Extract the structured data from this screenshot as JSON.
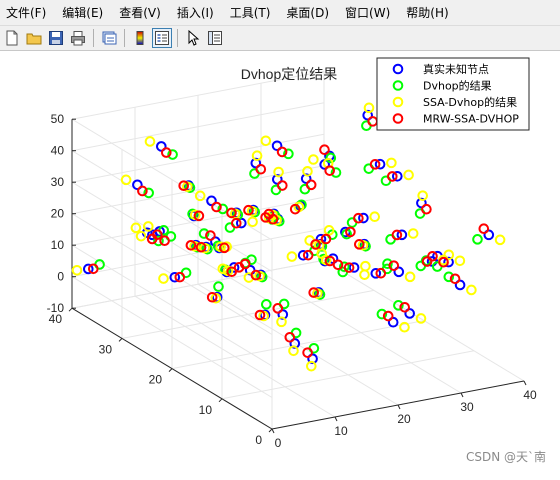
{
  "menubar": {
    "items": [
      {
        "label": "文件(F)"
      },
      {
        "label": "编辑(E)"
      },
      {
        "label": "查看(V)"
      },
      {
        "label": "插入(I)"
      },
      {
        "label": "工具(T)"
      },
      {
        "label": "桌面(D)"
      },
      {
        "label": "窗口(W)"
      },
      {
        "label": "帮助(H)"
      }
    ]
  },
  "toolbar": {
    "icons": [
      "new-file-icon",
      "open-folder-icon",
      "save-icon",
      "print-icon",
      "link-figure-icon",
      "colorbar-icon",
      "legend-icon",
      "pointer-icon",
      "property-inspector-icon"
    ]
  },
  "colors": {
    "true_nodes": "#0000ff",
    "dvhop": "#00ff00",
    "ssa_dvhop": "#ffff00",
    "mrw_ssa_dvhop": "#ff0000"
  },
  "chart_data": {
    "type": "scatter",
    "projection": "3d",
    "title": "Dvhop定位结果",
    "xlabel": "",
    "ylabel": "",
    "zlabel": "",
    "xlim": [
      0,
      40
    ],
    "ylim": [
      0,
      40
    ],
    "zlim": [
      -10,
      50
    ],
    "xticks": [
      "0",
      "10",
      "20",
      "30",
      "40"
    ],
    "yticks": [
      "0",
      "10",
      "20",
      "30",
      "40"
    ],
    "zticks": [
      "-10",
      "0",
      "10",
      "20",
      "30",
      "40",
      "50"
    ],
    "grid": true,
    "legend_position": "top-right",
    "legend": [
      "真实未知节点",
      "Dvhop的结果",
      "SSA-Dvhop的结果",
      "MRW-SSA-DVHOP"
    ],
    "series": [
      {
        "name": "真实未知节点",
        "marker": "circle",
        "color": "#0000ff",
        "points": [
          [
            18,
            8,
            38
          ],
          [
            2,
            25,
            28
          ],
          [
            14,
            12,
            44
          ],
          [
            8,
            34,
            16
          ],
          [
            25,
            20,
            48
          ],
          [
            17,
            5,
            30
          ],
          [
            4,
            16,
            15
          ],
          [
            30,
            28,
            12
          ],
          [
            21,
            37,
            4
          ],
          [
            3,
            6,
            32
          ],
          [
            36,
            2,
            36
          ],
          [
            10,
            14,
            9
          ],
          [
            22,
            28,
            22
          ],
          [
            13,
            32,
            22
          ],
          [
            38,
            18,
            30
          ],
          [
            6,
            3,
            12
          ],
          [
            15,
            26,
            28
          ],
          [
            29,
            9,
            7
          ],
          [
            27,
            33,
            38
          ],
          [
            11,
            20,
            32
          ],
          [
            20,
            13,
            24
          ],
          [
            33,
            31,
            1
          ],
          [
            23,
            3,
            40
          ],
          [
            1,
            38,
            4
          ],
          [
            9,
            28,
            37
          ],
          [
            35,
            11,
            21
          ],
          [
            16,
            18,
            3
          ],
          [
            26,
            36,
            30
          ],
          [
            7,
            22,
            24
          ],
          [
            31,
            14,
            45
          ],
          [
            19,
            33,
            1
          ],
          [
            12,
            7,
            1
          ],
          [
            37,
            25,
            36
          ],
          [
            24,
            24,
            13
          ],
          [
            5,
            10,
            48
          ],
          [
            28,
            17,
            30
          ],
          [
            34,
            36,
            22
          ],
          [
            14,
            22,
            14
          ],
          [
            21,
            8,
            33
          ],
          [
            8,
            37,
            29
          ],
          [
            32,
            5,
            26
          ],
          [
            17,
            29,
            7
          ],
          [
            39,
            30,
            46
          ],
          [
            3,
            19,
            29
          ],
          [
            26,
            12,
            18
          ],
          [
            11,
            36,
            41
          ],
          [
            22,
            18,
            23
          ],
          [
            36,
            20,
            7
          ],
          [
            9,
            2,
            28
          ],
          [
            29,
            26,
            38
          ],
          [
            18,
            34,
            10
          ],
          [
            4,
            30,
            22
          ],
          [
            24,
            6,
            9
          ],
          [
            31,
            38,
            21
          ],
          [
            13,
            16,
            38
          ],
          [
            20,
            24,
            26
          ],
          [
            37,
            9,
            13
          ],
          [
            6,
            27,
            10
          ],
          [
            27,
            2,
            31
          ],
          [
            15,
            31,
            27
          ]
        ]
      },
      {
        "name": "Dvhop的结果",
        "marker": "circle",
        "color": "#00ff00",
        "points": [
          [
            19,
            9,
            36
          ],
          [
            3,
            24,
            27
          ],
          [
            15,
            13,
            43
          ],
          [
            9,
            33,
            18
          ],
          [
            26,
            21,
            46
          ],
          [
            16,
            6,
            28
          ],
          [
            5,
            17,
            17
          ],
          [
            31,
            27,
            14
          ],
          [
            20,
            36,
            6
          ],
          [
            4,
            7,
            30
          ],
          [
            35,
            3,
            34
          ],
          [
            11,
            15,
            11
          ],
          [
            23,
            29,
            20
          ],
          [
            12,
            31,
            24
          ],
          [
            37,
            17,
            28
          ],
          [
            7,
            4,
            14
          ],
          [
            16,
            27,
            26
          ],
          [
            28,
            10,
            9
          ],
          [
            28,
            32,
            36
          ],
          [
            10,
            21,
            30
          ],
          [
            21,
            12,
            22
          ],
          [
            32,
            30,
            3
          ],
          [
            22,
            4,
            38
          ],
          [
            2,
            37,
            6
          ],
          [
            10,
            29,
            35
          ],
          [
            34,
            12,
            19
          ],
          [
            17,
            19,
            5
          ],
          [
            25,
            35,
            28
          ],
          [
            8,
            23,
            22
          ],
          [
            30,
            15,
            43
          ],
          [
            18,
            32,
            3
          ],
          [
            13,
            8,
            3
          ],
          [
            36,
            26,
            34
          ],
          [
            25,
            23,
            15
          ],
          [
            6,
            11,
            46
          ],
          [
            27,
            18,
            28
          ],
          [
            33,
            35,
            20
          ],
          [
            15,
            23,
            16
          ],
          [
            22,
            9,
            31
          ],
          [
            9,
            36,
            27
          ],
          [
            31,
            6,
            24
          ],
          [
            18,
            28,
            9
          ],
          [
            38,
            29,
            44
          ],
          [
            4,
            20,
            27
          ],
          [
            27,
            11,
            20
          ],
          [
            12,
            35,
            39
          ],
          [
            23,
            19,
            21
          ],
          [
            35,
            21,
            9
          ],
          [
            10,
            3,
            26
          ],
          [
            30,
            25,
            36
          ],
          [
            17,
            35,
            12
          ],
          [
            5,
            29,
            20
          ],
          [
            23,
            7,
            11
          ],
          [
            30,
            37,
            19
          ],
          [
            14,
            17,
            36
          ],
          [
            21,
            25,
            24
          ],
          [
            36,
            10,
            15
          ],
          [
            7,
            26,
            12
          ],
          [
            26,
            3,
            29
          ],
          [
            16,
            30,
            25
          ]
        ]
      },
      {
        "name": "SSA-Dvhop的结果",
        "marker": "circle",
        "color": "#ffff00",
        "points": [
          [
            17,
            10,
            37
          ],
          [
            1,
            26,
            29
          ],
          [
            13,
            11,
            45
          ],
          [
            7,
            35,
            15
          ],
          [
            24,
            19,
            47
          ],
          [
            18,
            4,
            31
          ],
          [
            3,
            15,
            16
          ],
          [
            29,
            29,
            11
          ],
          [
            22,
            38,
            3
          ],
          [
            2,
            5,
            33
          ],
          [
            37,
            1,
            35
          ],
          [
            9,
            13,
            10
          ],
          [
            21,
            27,
            23
          ],
          [
            14,
            33,
            21
          ],
          [
            39,
            19,
            31
          ],
          [
            5,
            2,
            11
          ],
          [
            14,
            25,
            29
          ],
          [
            30,
            8,
            6
          ],
          [
            26,
            34,
            39
          ],
          [
            12,
            19,
            33
          ],
          [
            19,
            14,
            25
          ],
          [
            34,
            32,
            0
          ],
          [
            24,
            2,
            41
          ],
          [
            0,
            39,
            3
          ],
          [
            8,
            27,
            38
          ],
          [
            36,
            10,
            22
          ],
          [
            15,
            17,
            2
          ],
          [
            27,
            37,
            31
          ],
          [
            6,
            21,
            25
          ],
          [
            32,
            13,
            46
          ],
          [
            20,
            34,
            0
          ],
          [
            11,
            6,
            0
          ],
          [
            38,
            24,
            37
          ],
          [
            23,
            25,
            12
          ],
          [
            4,
            9,
            49
          ],
          [
            29,
            16,
            31
          ],
          [
            35,
            37,
            23
          ],
          [
            13,
            21,
            13
          ],
          [
            20,
            7,
            34
          ],
          [
            7,
            38,
            30
          ],
          [
            33,
            4,
            27
          ],
          [
            16,
            30,
            6
          ],
          [
            40,
            31,
            47
          ],
          [
            2,
            18,
            30
          ],
          [
            25,
            13,
            17
          ],
          [
            10,
            37,
            42
          ],
          [
            21,
            17,
            24
          ],
          [
            37,
            19,
            6
          ],
          [
            8,
            1,
            29
          ],
          [
            28,
            27,
            39
          ],
          [
            19,
            33,
            9
          ],
          [
            3,
            31,
            23
          ],
          [
            25,
            5,
            8
          ],
          [
            32,
            39,
            22
          ],
          [
            12,
            15,
            39
          ],
          [
            19,
            23,
            27
          ],
          [
            38,
            8,
            12
          ],
          [
            5,
            28,
            9
          ],
          [
            28,
            1,
            32
          ],
          [
            14,
            32,
            28
          ]
        ]
      },
      {
        "name": "MRW-SSA-DVHOP",
        "marker": "circle",
        "color": "#ff0000",
        "points": [
          [
            18,
            7,
            39
          ],
          [
            2,
            24,
            26
          ],
          [
            14,
            13,
            42
          ],
          [
            8,
            33,
            17
          ],
          [
            25,
            21,
            49
          ],
          [
            17,
            6,
            29
          ],
          [
            4,
            17,
            14
          ],
          [
            30,
            27,
            13
          ],
          [
            21,
            36,
            5
          ],
          [
            3,
            7,
            31
          ],
          [
            36,
            3,
            37
          ],
          [
            10,
            15,
            8
          ],
          [
            22,
            29,
            21
          ],
          [
            13,
            31,
            23
          ],
          [
            38,
            17,
            29
          ],
          [
            6,
            4,
            13
          ],
          [
            15,
            27,
            27
          ],
          [
            29,
            10,
            8
          ],
          [
            27,
            32,
            37
          ],
          [
            11,
            21,
            31
          ],
          [
            20,
            12,
            23
          ],
          [
            33,
            30,
            2
          ],
          [
            23,
            4,
            39
          ],
          [
            1,
            37,
            5
          ],
          [
            9,
            29,
            36
          ],
          [
            35,
            12,
            20
          ],
          [
            16,
            19,
            4
          ],
          [
            26,
            35,
            29
          ],
          [
            7,
            23,
            23
          ],
          [
            31,
            15,
            44
          ],
          [
            19,
            32,
            2
          ],
          [
            12,
            8,
            2
          ],
          [
            37,
            26,
            35
          ],
          [
            24,
            23,
            14
          ],
          [
            5,
            11,
            47
          ],
          [
            28,
            18,
            29
          ],
          [
            34,
            35,
            21
          ],
          [
            14,
            23,
            15
          ],
          [
            21,
            9,
            32
          ],
          [
            8,
            36,
            28
          ],
          [
            32,
            6,
            25
          ],
          [
            17,
            28,
            8
          ],
          [
            39,
            29,
            45
          ],
          [
            3,
            20,
            28
          ],
          [
            26,
            11,
            19
          ],
          [
            11,
            35,
            40
          ],
          [
            22,
            19,
            22
          ],
          [
            36,
            21,
            8
          ],
          [
            9,
            3,
            27
          ],
          [
            29,
            25,
            37
          ],
          [
            18,
            35,
            11
          ],
          [
            4,
            29,
            21
          ],
          [
            24,
            7,
            10
          ],
          [
            31,
            37,
            20
          ],
          [
            13,
            17,
            37
          ],
          [
            20,
            25,
            25
          ],
          [
            37,
            10,
            14
          ],
          [
            6,
            26,
            11
          ],
          [
            27,
            3,
            30
          ],
          [
            15,
            30,
            26
          ]
        ]
      }
    ]
  },
  "watermark": "CSDN @天`南"
}
